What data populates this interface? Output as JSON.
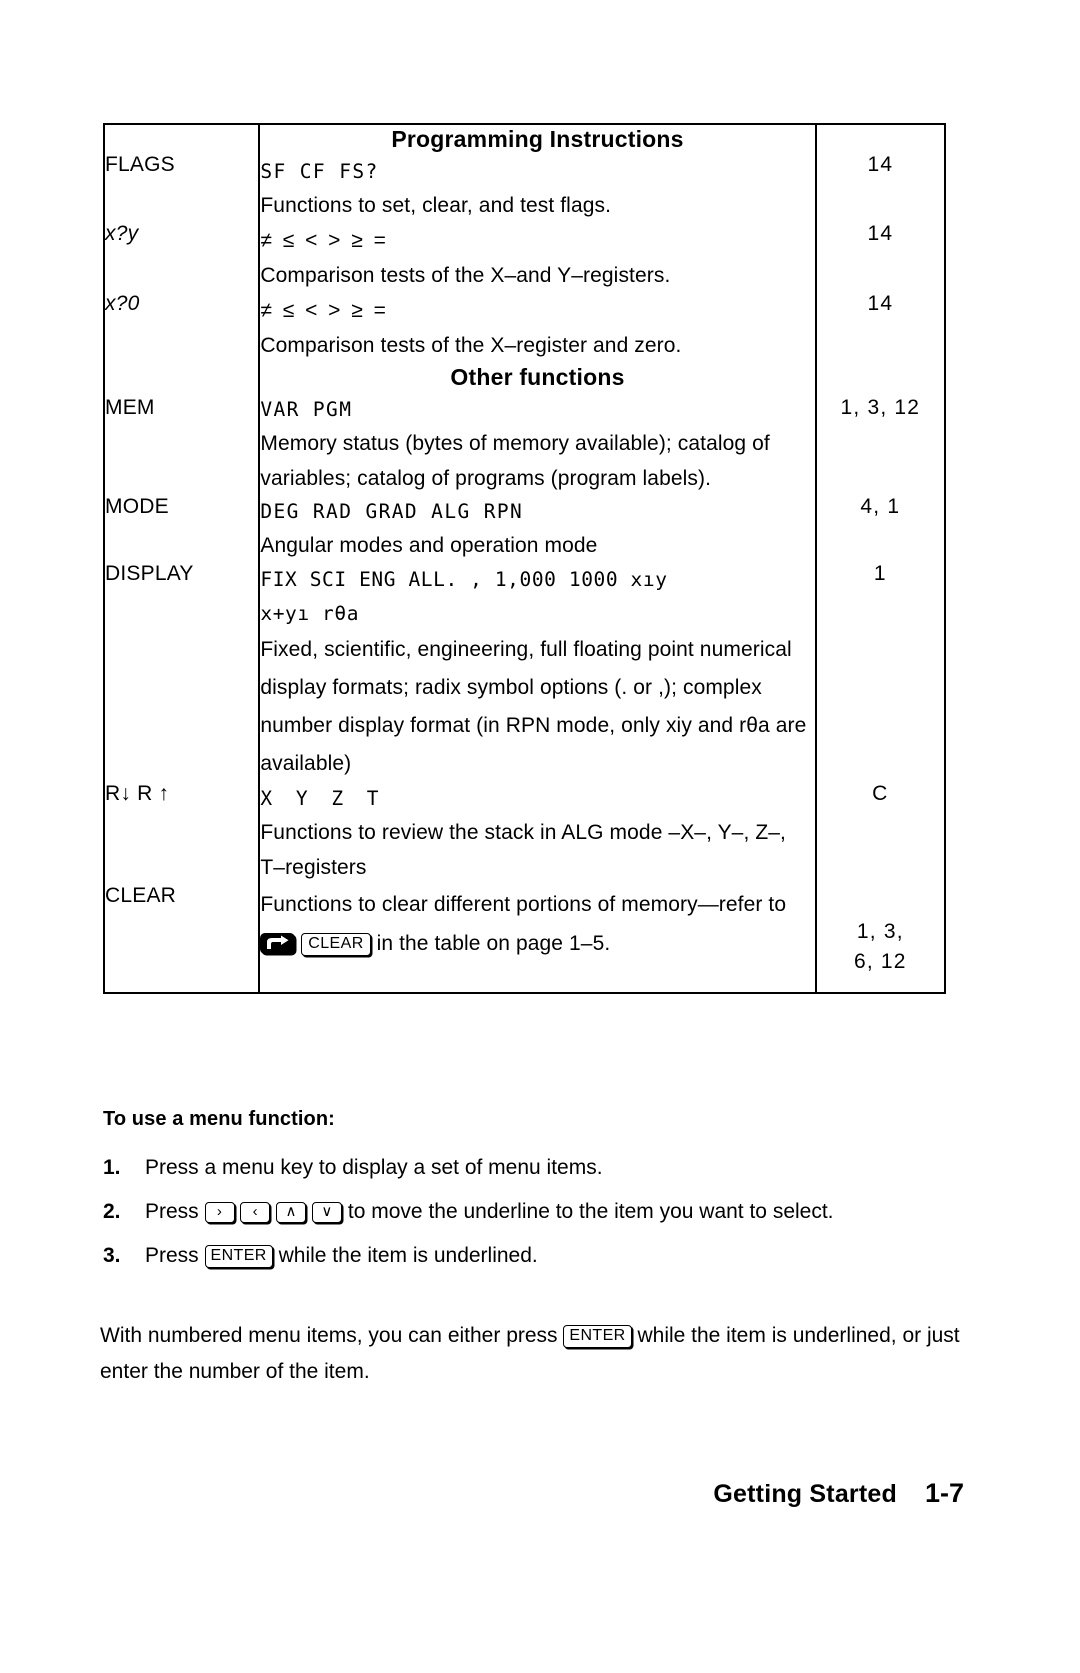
{
  "table": {
    "headers": {
      "programming": "Programming Instructions",
      "other": "Other functions"
    },
    "rows": [
      {
        "key": "FLAGS",
        "ops": "SF CF FS?",
        "desc": "Functions to set, clear, and test flags.",
        "page": "14"
      },
      {
        "key": "x?y",
        "ops": "≠ ≤ < > ≥ =",
        "desc": "Comparison tests of the X–and Y–registers.",
        "page": "14"
      },
      {
        "key": "x?0",
        "ops": "≠ ≤ < > ≥ =",
        "desc": "Comparison tests of the X–register and zero.",
        "page": "14"
      },
      {
        "key": "MEM",
        "ops": "VAR PGM",
        "desc": "Memory status (bytes of memory available); catalog of variables; catalog of programs (program labels).",
        "page": "1, 3, 12"
      },
      {
        "key": "MODE",
        "ops": "DEG RAD GRAD ALG RPN",
        "desc": "Angular modes and operation mode",
        "page": "4, 1"
      },
      {
        "key": "DISPLAY",
        "ops": "FIX SCI ENG ALL. , 1,000 1000 xıy",
        "ops2": "x+yı rθa",
        "desc": "Fixed, scientific, engineering, full floating point numerical display formats; radix symbol options (. or ,); complex number display format (in RPN mode, only xiy and rθa are available)",
        "page": "1"
      },
      {
        "key": "R↓  R ↑",
        "ops": "X Y Z T",
        "desc": "Functions to review the stack in ALG mode –X–, Y–, Z–, T–registers",
        "page": "C"
      },
      {
        "key": "CLEAR",
        "desc_pre": "Functions to clear different portions of memory—refer to",
        "desc_post": "in the table on page 1–5.",
        "key_shift": "shift-key-icon",
        "key_clear": "CLEAR",
        "page": "1, 3,",
        "page2": "6, 12"
      }
    ]
  },
  "instructions": {
    "lead": "To use a menu function:",
    "steps": [
      {
        "num": "1.",
        "text": "Press a menu key to display a set of menu items."
      },
      {
        "num": "2.",
        "pre": "Press",
        "keys": [
          "›",
          "‹",
          "∧",
          "∨"
        ],
        "post": "to move the underline to the item you want to select."
      },
      {
        "num": "3.",
        "pre": "Press",
        "key": "ENTER",
        "post": "while the item is underlined."
      }
    ],
    "paragraph_pre": "With numbered menu items, you can either press",
    "paragraph_key": "ENTER",
    "paragraph_post": "while the item is underlined, or just enter the number of the item."
  },
  "footer": {
    "title": "Getting Started",
    "page": "1-7"
  }
}
